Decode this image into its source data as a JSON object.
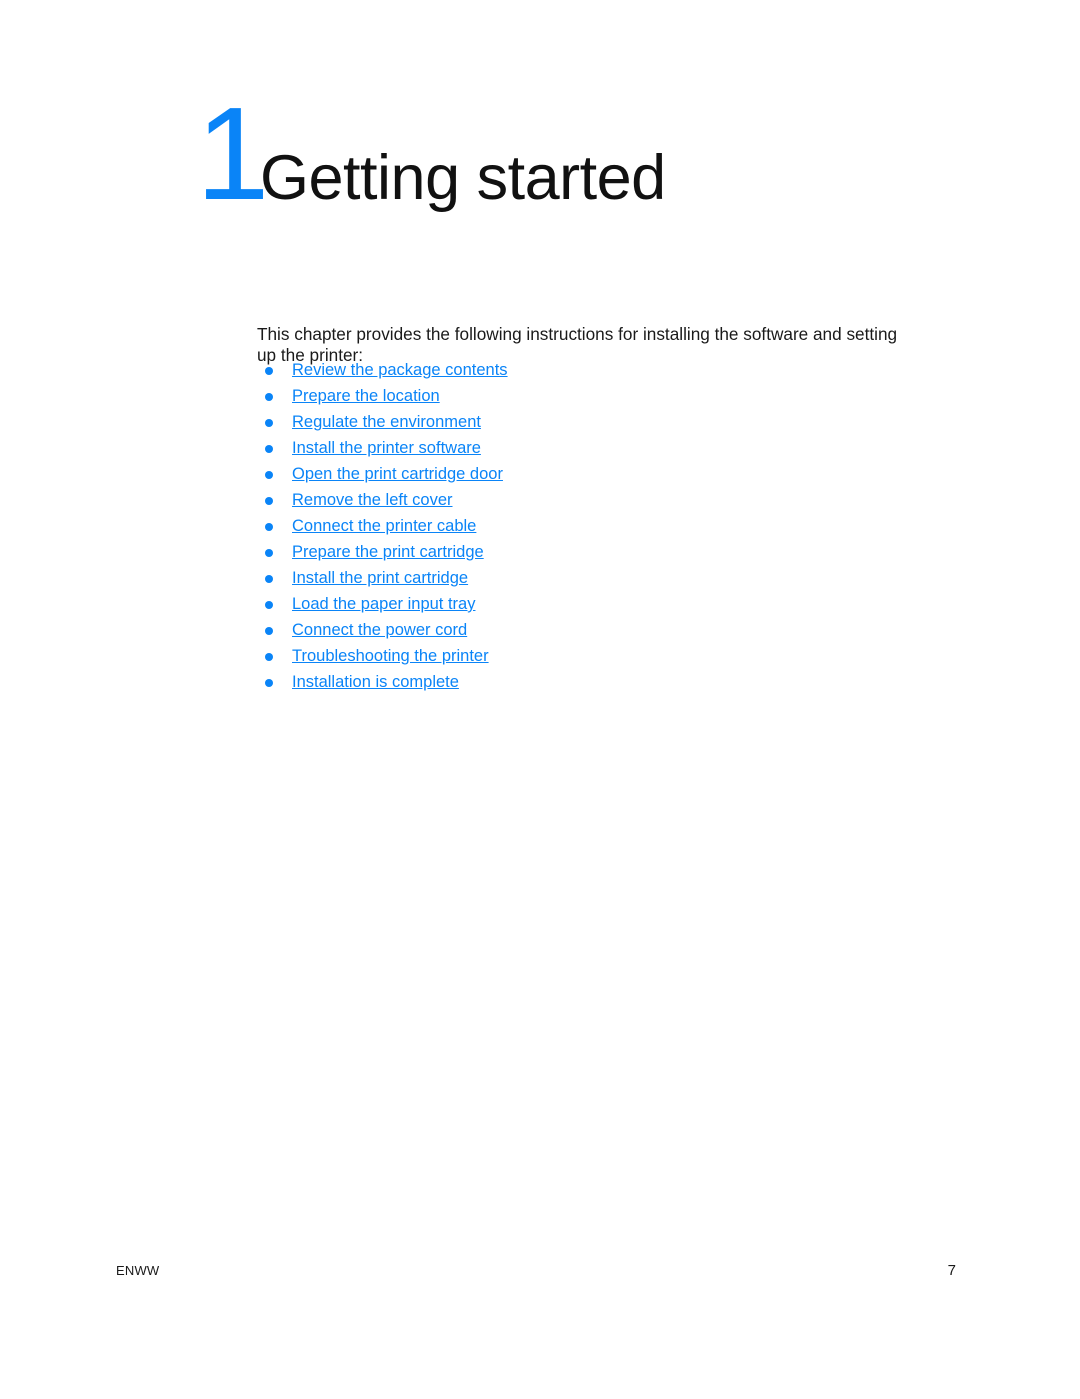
{
  "document": {
    "chapter_number": "1",
    "chapter_title": "Getting started",
    "intro_paragraph": "This chapter provides the following instructions for installing the software and setting up the printer:",
    "accent_color": "#0a84f7",
    "text_color": "#1a1a1a",
    "background_color": "#ffffff"
  },
  "contents": {
    "links": [
      {
        "label": "Review the package contents"
      },
      {
        "label": "Prepare the location"
      },
      {
        "label": "Regulate the environment"
      },
      {
        "label": "Install the printer software"
      },
      {
        "label": "Open the print cartridge door"
      },
      {
        "label": "Remove the left cover"
      },
      {
        "label": "Connect the printer cable"
      },
      {
        "label": "Prepare the print cartridge"
      },
      {
        "label": "Install the print cartridge"
      },
      {
        "label": "Load the paper input tray"
      },
      {
        "label": "Connect the power cord"
      },
      {
        "label": "Troubleshooting the printer"
      },
      {
        "label": "Installation is complete"
      }
    ]
  },
  "footer": {
    "locale_code": "ENWW",
    "page_number": "7"
  }
}
